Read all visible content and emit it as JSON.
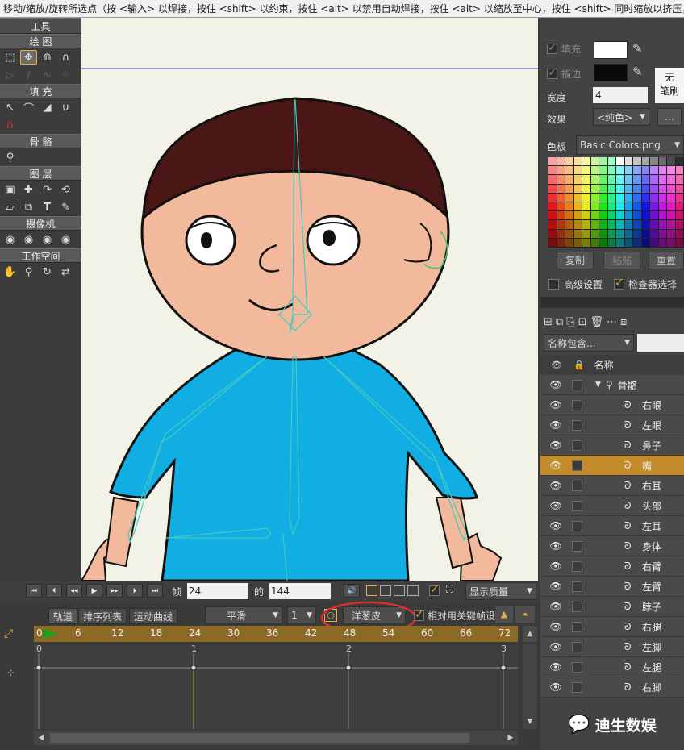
{
  "status_text": "移动/缩放/旋转所选点（按 <输入> 以焊接，按住 <shift> 以约束，按住 <alt> 以禁用自动焊接，按住 <alt> 以缩放至中心，按住 <shift> 同时缩放以挤压，",
  "tools": {
    "title": "工具",
    "sections": [
      "绘 图",
      "填 充",
      "骨 骼",
      "图 层",
      "摄像机",
      "工作空间"
    ]
  },
  "style_panel": {
    "fill_label": "填充",
    "stroke_label": "描边",
    "fill_color": "#ffffff",
    "stroke_color": "#0a0a0a",
    "no_brush_line1": "无",
    "no_brush_line2": "笔刷",
    "width_label": "宽度",
    "width_value": "4",
    "effect_label": "效果",
    "effect_value": "<纯色>",
    "effect_more": "...",
    "palette_label": "色板",
    "palette_value": "Basic Colors.png",
    "copy_button": "复制",
    "paste_button": "粘贴",
    "reset_button": "重置",
    "advanced_label": "高级设置",
    "inspector_label": "检查器选择"
  },
  "layers_panel": {
    "filter_label": "名称包含...",
    "filter_value": "",
    "name_header": "名称",
    "group_name": "骨骼",
    "items": [
      "右眼",
      "左眼",
      "鼻子",
      "嘴",
      "右耳",
      "头部",
      "左耳",
      "身体",
      "右臂",
      "左臂",
      "脖子",
      "右腿",
      "左脚",
      "左腿",
      "右脚"
    ],
    "selected_index": 3
  },
  "transport": {
    "frame_label": "帧",
    "frame_value": "24",
    "of_label": "的",
    "total_frames": "144",
    "quality": "显示质量"
  },
  "timeline": {
    "tabs": [
      "轨道",
      "排序列表",
      "运动曲线"
    ],
    "interp": "平滑",
    "interp_count": "1",
    "onion_label": "洋葱皮",
    "relative_label": "相对用关键帧设",
    "ruler_marks": [
      "0",
      "6",
      "12",
      "18",
      "24",
      "30",
      "36",
      "42",
      "48",
      "54",
      "60",
      "66",
      "72"
    ],
    "graph_marks": [
      "0",
      "1",
      "2",
      "3"
    ],
    "current_frame": 24
  },
  "watermark": "迪生数娱",
  "colors": {
    "accent": "#c48b2a",
    "canvas_bg": "#f3f2e6",
    "hair": "#4a1716",
    "skin": "#f2b99c",
    "shirt": "#10aee2",
    "bone": "#47c9c0",
    "onion_ring": "#d6302b"
  }
}
